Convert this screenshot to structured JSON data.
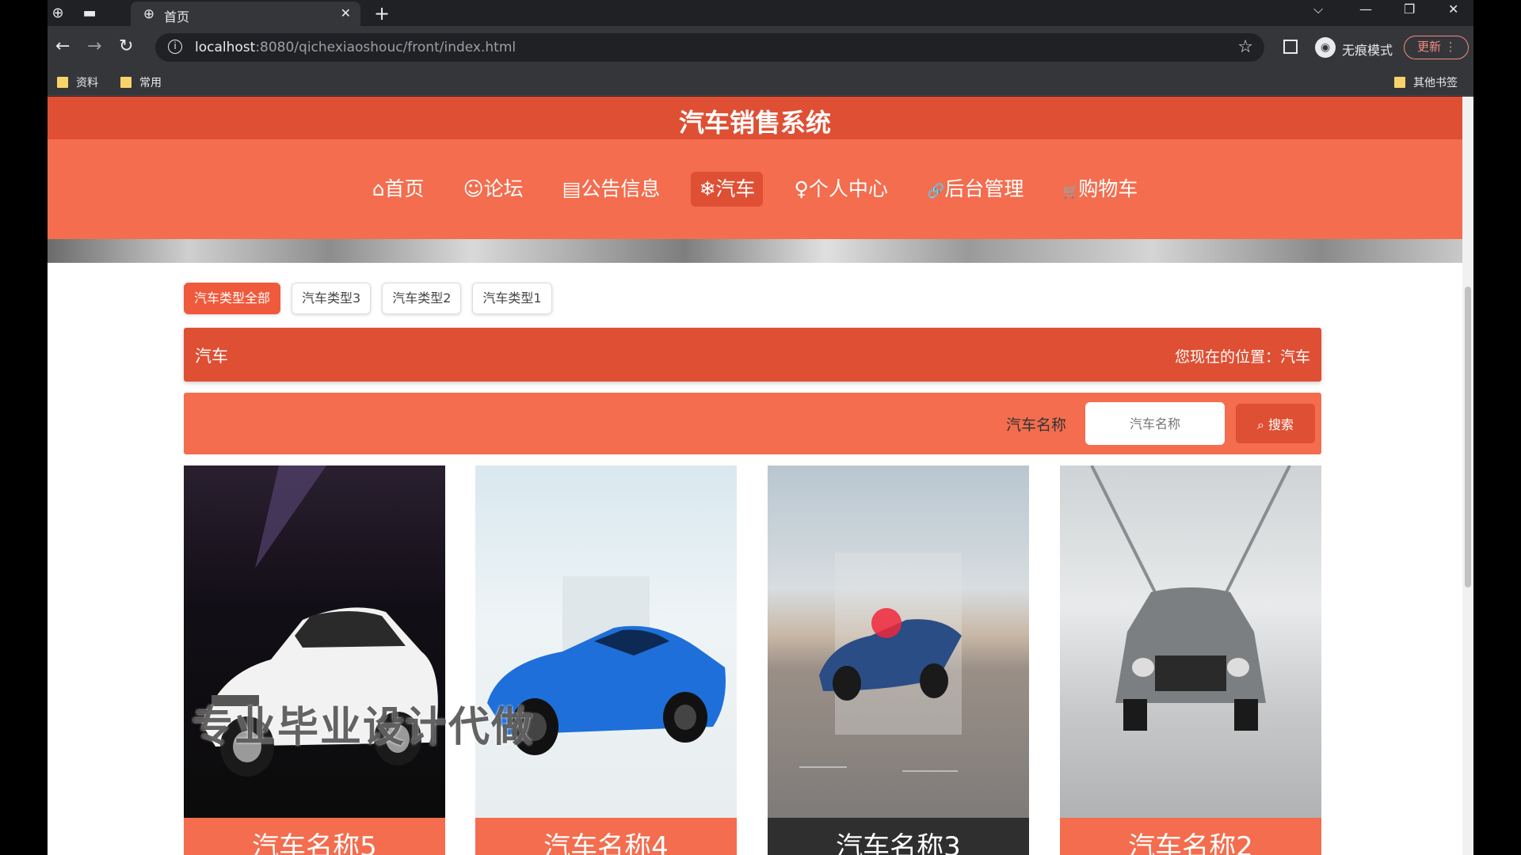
{
  "browser": {
    "tab_title": "首页",
    "url_host": "localhost",
    "url_rest": ":8080/qichexiaoshouc/front/index.html",
    "incognito_label": "无痕模式",
    "update_label": "更新",
    "bookmarks": [
      "资料",
      "常用"
    ],
    "other_bookmarks": "其他书签"
  },
  "site": {
    "title": "汽车销售系统"
  },
  "menu": [
    {
      "icon": "⌂",
      "label": "首页"
    },
    {
      "icon": "☺",
      "label": "论坛"
    },
    {
      "icon": "▤",
      "label": "公告信息"
    },
    {
      "icon": "❄",
      "label": "汽车"
    },
    {
      "icon": "♀",
      "label": "个人中心"
    },
    {
      "icon": "🔗",
      "label": "后台管理"
    },
    {
      "icon": "🛒",
      "label": "购物车"
    }
  ],
  "type_tabs": [
    "汽车类型全部",
    "汽车类型3",
    "汽车类型2",
    "汽车类型1"
  ],
  "section": {
    "title": "汽车",
    "location_prefix": "您现在的位置：",
    "location": "汽车"
  },
  "search": {
    "label": "汽车名称",
    "placeholder": "汽车名称",
    "button": "搜索"
  },
  "cars": [
    {
      "name": "汽车名称5",
      "color": "white"
    },
    {
      "name": "汽车名称4",
      "color": "blue"
    },
    {
      "name": "汽车名称3",
      "color": "navy"
    },
    {
      "name": "汽车名称2",
      "color": "silver"
    }
  ],
  "watermark": "专业毕业设计代做",
  "colors": {
    "primary": "#f36d4e",
    "primary_dark": "#df4f33"
  }
}
